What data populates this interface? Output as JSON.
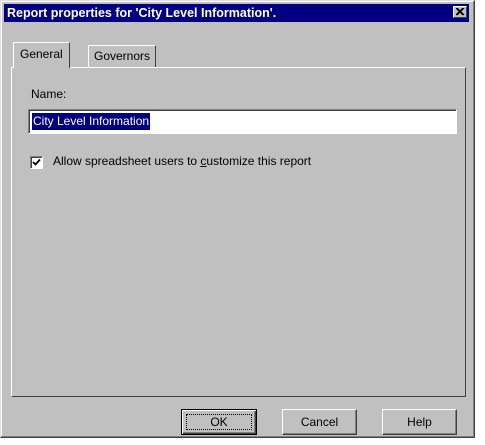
{
  "window": {
    "title": "Report properties for 'City Level Information'.",
    "close_icon": "close-icon"
  },
  "tabs": [
    {
      "label": "General",
      "active": true
    },
    {
      "label": "Governors",
      "active": false
    }
  ],
  "general": {
    "name_label": "Name:",
    "name_value": "City Level Information",
    "allow_customize": {
      "label_prefix": "Allow spreadsheet users to ",
      "label_mnemonic": "c",
      "label_suffix": "ustomize this report",
      "checked": true
    }
  },
  "buttons": {
    "ok": "OK",
    "cancel": "Cancel",
    "help": "Help"
  },
  "colors": {
    "titlebar": "#000080",
    "face": "#c0c0c0",
    "selection": "#000080"
  }
}
